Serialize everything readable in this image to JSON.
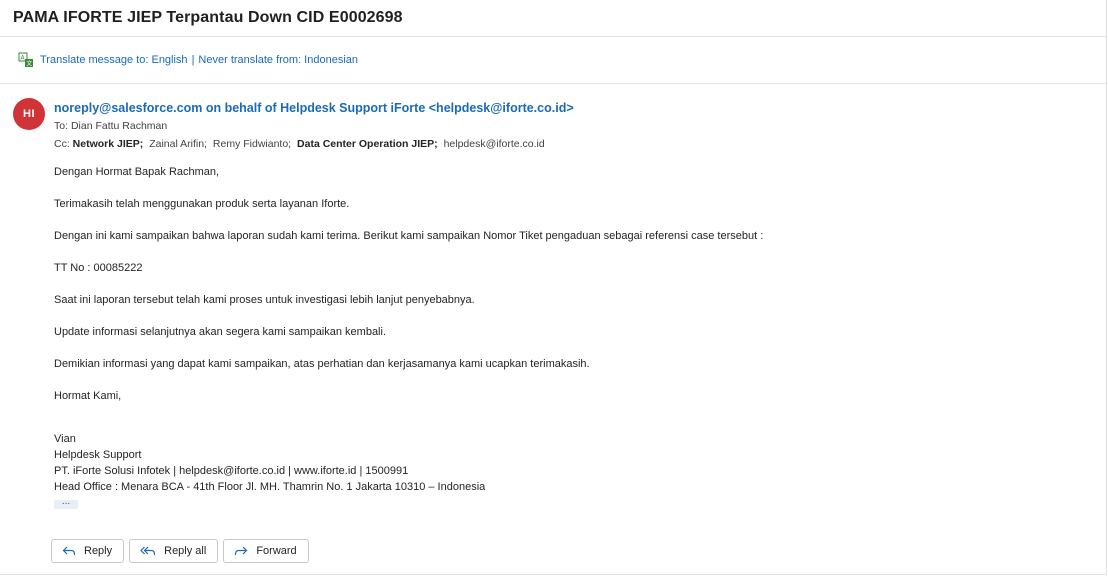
{
  "email": {
    "subject": "PAMA IFORTE JIEP Terpantau Down CID E0002698",
    "translate": {
      "to_label": "Translate message to: English",
      "separator": "|",
      "never_label": "Never translate from: Indonesian"
    },
    "avatar_initials": "HI",
    "avatar_color": "#d13438",
    "sender": "noreply@salesforce.com on behalf of Helpdesk Support iForte <helpdesk@iforte.co.id>",
    "to_prefix": "To:",
    "to": "Dian Fattu Rachman",
    "cc_prefix": "Cc:",
    "cc": [
      {
        "name": "Network JIEP;",
        "bold": true
      },
      {
        "name": "Zainal Arifin;",
        "bold": false
      },
      {
        "name": "Remy Fidwianto;",
        "bold": false
      },
      {
        "name": "Data Center Operation JIEP;",
        "bold": true
      },
      {
        "name": "helpdesk@iforte.co.id",
        "bold": false
      }
    ],
    "body": [
      "Dengan Hormat Bapak Rachman,",
      "Terimakasih telah menggunakan produk serta layanan Iforte.",
      "Dengan ini kami sampaikan bahwa laporan sudah kami terima. Berikut kami sampaikan Nomor Tiket pengaduan sebagai referensi case tersebut :",
      "TT No : 00085222",
      "Saat ini laporan tersebut telah kami proses untuk investigasi lebih lanjut penyebabnya.",
      "Update informasi selanjutnya akan segera kami sampaikan kembali.",
      "Demikian informasi yang dapat kami sampaikan, atas perhatian dan kerjasamanya kami ucapkan terimakasih.",
      "Hormat Kami,"
    ],
    "signature": [
      "Vian",
      "Helpdesk Support",
      "PT. iForte Solusi Infotek | helpdesk@iforte.co.id | www.iforte.id | 1500991",
      "Head Office : Menara BCA - 41th Floor Jl. MH. Thamrin No. 1 Jakarta 10310 – Indonesia"
    ],
    "ellipsis": "...",
    "accent_color": "#1b6ab8"
  },
  "actions": {
    "reply": "Reply",
    "reply_all": "Reply all",
    "forward": "Forward"
  }
}
